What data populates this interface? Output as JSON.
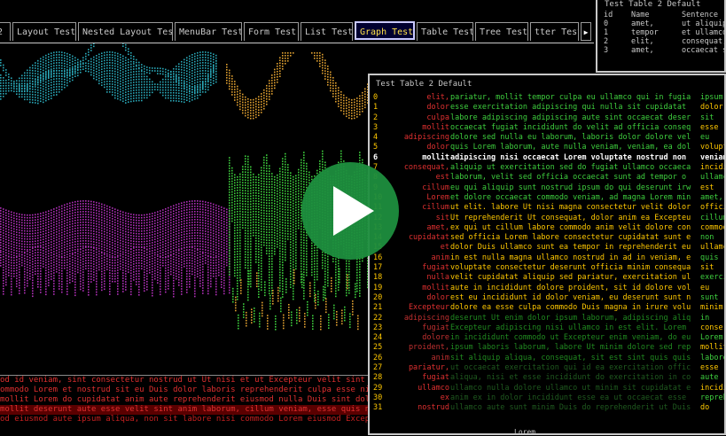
{
  "tabs": [
    {
      "label": "2"
    },
    {
      "label": "Layout Test"
    },
    {
      "label": "Nested Layout Test"
    },
    {
      "label": "MenuBar Test"
    },
    {
      "label": "Form Test"
    },
    {
      "label": "List Test"
    },
    {
      "label": "Graph Test",
      "active": true
    },
    {
      "label": "Table Test"
    },
    {
      "label": "Tree Test"
    },
    {
      "label": "tter Test"
    }
  ],
  "tab_scroll_arrow": "▶",
  "table1": {
    "title": "Test Table 2 Default",
    "headers": [
      "id",
      "Name",
      "Sentence"
    ],
    "rows": [
      [
        "0",
        "amet,",
        "ut aliquip"
      ],
      [
        "1",
        "tempor",
        "et ullamco"
      ],
      [
        "2",
        "elit,",
        "consequat,"
      ],
      [
        "3",
        "amet,",
        "occaecat s"
      ]
    ]
  },
  "table2": {
    "title": "Test Table 2 Default",
    "selected_index": 6,
    "rows": [
      {
        "id": "0",
        "name": "elit,",
        "sentence": "pariatur, mollit tempor culpa eu ullamco qui in fugia",
        "extra": "ipsum"
      },
      {
        "id": "1",
        "name": "dolor",
        "sentence": "esse exercitation adipiscing qui nulla sit cupidatat",
        "extra": "dolor"
      },
      {
        "id": "2",
        "name": "culpa",
        "sentence": "labore adipiscing adipiscing aute sint occaecat deser",
        "extra": "sit"
      },
      {
        "id": "3",
        "name": "mollit",
        "sentence": "occaecat fugiat incididunt do velit ad officia conseq",
        "extra": "esse"
      },
      {
        "id": "4",
        "name": "adipiscing",
        "sentence": "dolore sed nulla eu laborum, laboris dolor dolore vel",
        "extra": "eu"
      },
      {
        "id": "5",
        "name": "dolor",
        "sentence": "quis Lorem laborum, aute nulla veniam, veniam, ea dol",
        "extra": "volupt"
      },
      {
        "id": "6",
        "name": "mollit",
        "sentence": "adipiscing nisi occaecat Lorem voluptate nostrud non",
        "extra": "veniam"
      },
      {
        "id": "7",
        "name": "consequat,",
        "sentence": "aliquip ut exercitation sed do fugiat ullamco occaeca",
        "extra": "incidi"
      },
      {
        "id": "8",
        "name": "est",
        "sentence": "laborum, velit sed officia occaecat sunt ad tempor o",
        "extra": "ullamc"
      },
      {
        "id": "9",
        "name": "cillum",
        "sentence": "eu qui aliquip sunt nostrud ipsum do qui deserunt irw",
        "extra": "est"
      },
      {
        "id": "10",
        "name": "Lorem",
        "sentence": "et dolore occaecat commodo veniam, ad magna Lorem min",
        "extra": "amet,"
      },
      {
        "id": "11",
        "name": "cillum",
        "sentence": "ut elit. labore Ut nisi magna consectetur velit dolor",
        "extra": "offici"
      },
      {
        "id": "12",
        "name": "sit",
        "sentence": "Ut reprehenderit Ut consequat, dolor anim ea Excepteu",
        "extra": "cillum"
      },
      {
        "id": "13",
        "name": "amet,",
        "sentence": "ex qui ut cillum labore commodo anim velit dolore con",
        "extra": "commod"
      },
      {
        "id": "14",
        "name": "cupidatat",
        "sentence": "sed officia Lorem labore consectetur cupidatat sunt e",
        "extra": "non"
      },
      {
        "id": "15",
        "name": "et",
        "sentence": "dolor Duis ullamco sunt ea tempor in reprehenderit eu",
        "extra": "ullamc"
      },
      {
        "id": "16",
        "name": "anim",
        "sentence": "in est nulla magna ullamco nostrud in ad in veniam, e",
        "extra": "quis"
      },
      {
        "id": "17",
        "name": "fugiat",
        "sentence": "voluptate consectetur deserunt officia minim consequa",
        "extra": "sit"
      },
      {
        "id": "18",
        "name": "nulla",
        "sentence": "velit cupidatat aliquip sed pariatur, exercitation ul",
        "extra": "exerci"
      },
      {
        "id": "19",
        "name": "mollit",
        "sentence": "aute in incididunt dolore proident, sit id dolore vol",
        "extra": "eu"
      },
      {
        "id": "20",
        "name": "dolor",
        "sentence": "est eu incididunt id dolor veniam, eu deserunt sunt n",
        "extra": "sunt"
      },
      {
        "id": "21",
        "name": "Excepteur",
        "sentence": "dolore ea esse culpa commodo Duis magna in irure volu",
        "extra": "minim"
      },
      {
        "id": "22",
        "name": "adipiscing",
        "sentence": "deserunt Ut enim dolor ipsum laborum, adipiscing aliq",
        "extra": "in"
      },
      {
        "id": "23",
        "name": "fugiat",
        "sentence": "Excepteur adipiscing nisi ullamco in est elit. Lorem",
        "extra": "conse"
      },
      {
        "id": "24",
        "name": "dolore",
        "sentence": "in incididunt commodo ut Excepteur enim veniam, do eu",
        "extra": "Lorem"
      },
      {
        "id": "25",
        "name": "proident,",
        "sentence": "ipsum laboris laborum, labore Ut minim dolore sed rep",
        "extra": "mollit"
      },
      {
        "id": "26",
        "name": "anim",
        "sentence": "sit aliquip aliqua, consequat, sit est sint quis quis",
        "extra": "labore"
      },
      {
        "id": "27",
        "name": "pariatur,",
        "sentence": "ut occaecat exercitation qui id ea exercitation offic",
        "extra": "esse"
      },
      {
        "id": "28",
        "name": "fugiat",
        "sentence": "aliqua, nisi et esse incididunt do exercitation in co",
        "extra": "aute"
      },
      {
        "id": "29",
        "name": "ullamco",
        "sentence": "ullamco nulla dolore ullamco ut minim sit cupidatat e",
        "extra": "incidi"
      },
      {
        "id": "30",
        "name": "ex",
        "sentence": "anim ex in dolor incididunt esse ea ut occaecat esse",
        "extra": "repreh"
      },
      {
        "id": "31",
        "name": "nostrud",
        "sentence": "ullamco aute sunt minim Duis do reprehenderit ut Duis",
        "extra": "do"
      }
    ]
  },
  "bottom_lines": [
    "od id veniam, sint consectetur nostrud ut Ut nisi et ut Excepteur velit sint al",
    "ommodo Lorem et nostrud sit eu Duis dolor laboris reprehenderit culpa esse nisi",
    "mollit Lorem do cupidatat anim aute reprehenderit eiusmod nulla Duis sint dolor",
    "mollit deserunt aute esse velit sint anim laborum, cillum veniam, esse quis ni",
    "od eiusmod aute ipsum aliqua, non sit labore nisi commodo Lorem eiusmod Excepteur exercit nostrud"
  ],
  "mini_label": "Lorem",
  "colors": {
    "red": "#e03030",
    "green": "#3ecf3e",
    "yellow": "#ffc800",
    "cyan": "#2aa8b8",
    "magenta": "#b030b8",
    "orange": "#e0a030"
  }
}
